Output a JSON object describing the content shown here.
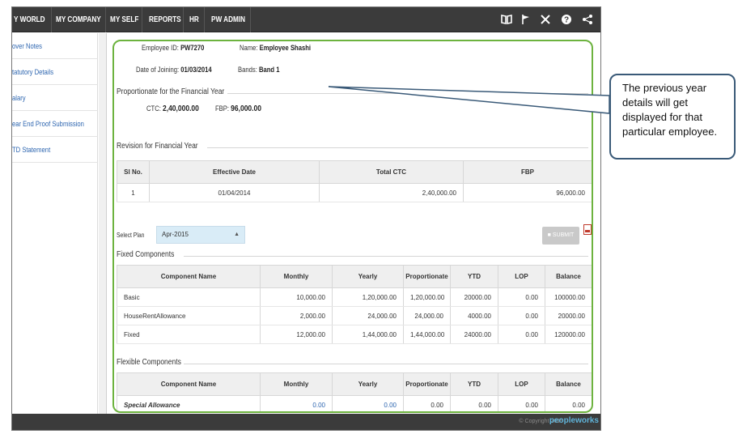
{
  "nav": {
    "items": [
      "Y WORLD",
      "MY COMPANY",
      "MY SELF",
      "REPORTS",
      "HR",
      "PW ADMIN"
    ],
    "icons": [
      "book-icon",
      "flag-icon",
      "tools-icon",
      "help-icon",
      "share-icon"
    ]
  },
  "sidebar": {
    "items": [
      "over Notes",
      "tatutory Details",
      "alary",
      "ear End Proof Submission",
      "TD Statement"
    ]
  },
  "employee": {
    "id_label": "Employee ID:",
    "id_value": "PW7270",
    "name_label": "Name:",
    "name_value": "Employee Shashi",
    "doj_label": "Date of Joining:",
    "doj_value": "01/03/2014",
    "bands_label": "Bands:",
    "bands_value": "Band 1"
  },
  "proportionate": {
    "title": "Proportionate for the Financial Year",
    "ctc_label": "CTC:",
    "ctc_value": "2,40,000.00",
    "fbp_label": "FBP:",
    "fbp_value": "96,000.00"
  },
  "revision": {
    "title": "Revision for Financial Year",
    "headers": [
      "Sl No.",
      "Effective Date",
      "Total CTC",
      "FBP"
    ],
    "rows": [
      [
        "1",
        "01/04/2014",
        "2,40,000.00",
        "96,000.00"
      ]
    ]
  },
  "plan": {
    "label": "Select Plan",
    "value": "Apr-2015",
    "submit": "SUBMIT"
  },
  "fixed": {
    "title": "Fixed Components",
    "headers": [
      "Component Name",
      "Monthly",
      "Yearly",
      "Proportionate",
      "YTD",
      "LOP",
      "Balance"
    ],
    "rows": [
      [
        "Basic",
        "10,000.00",
        "1,20,000.00",
        "1,20,000.00",
        "20000.00",
        "0.00",
        "100000.00"
      ],
      [
        "HouseRentAllowance",
        "2,000.00",
        "24,000.00",
        "24,000.00",
        "4000.00",
        "0.00",
        "20000.00"
      ],
      [
        "Fixed",
        "12,000.00",
        "1,44,000.00",
        "1,44,000.00",
        "24000.00",
        "0.00",
        "120000.00"
      ]
    ]
  },
  "flexible": {
    "title": "Flexible Components",
    "headers": [
      "Component Name",
      "Monthly",
      "Yearly",
      "Proportionate",
      "YTD",
      "LOP",
      "Balance"
    ],
    "rows": [
      [
        "Special Allowance",
        "0.00",
        "0.00",
        "0.00",
        "0.00",
        "0.00",
        "0.00"
      ]
    ]
  },
  "footer": {
    "copyright": "© Copyright 2015",
    "brand": "peopleworks"
  },
  "callout": {
    "text": "The previous year details will get displayed for that particular employee."
  },
  "colors": {
    "panel_border": "#6db33f",
    "topbar": "#3b3b3b",
    "link": "#2e66b0",
    "callout_border": "#3a5a78"
  }
}
